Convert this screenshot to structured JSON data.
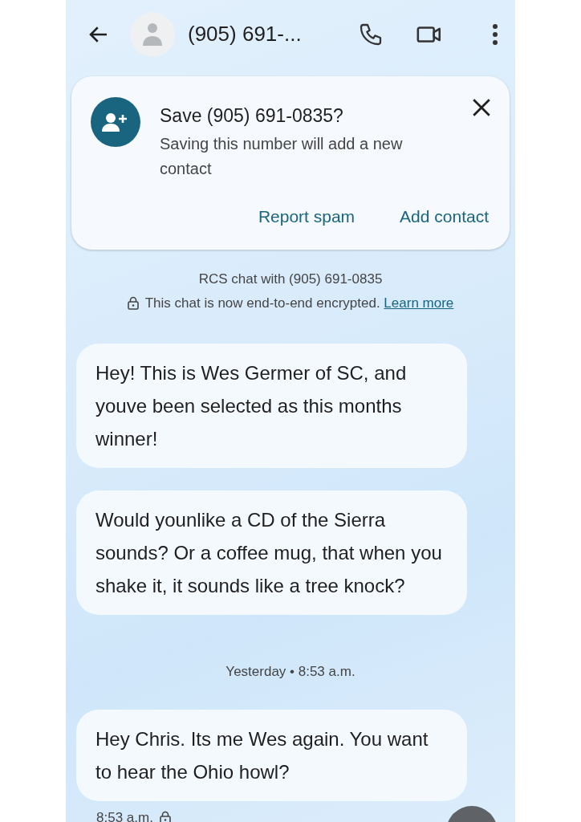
{
  "header": {
    "title": "(905) 691-..."
  },
  "save_banner": {
    "title": "Save (905) 691-0835?",
    "message": "Saving this number will add a new contact",
    "actions": [
      "Report spam",
      "Add contact"
    ]
  },
  "chat_info": {
    "line": "RCS chat with (905) 691-0835",
    "encryption_text": "This chat is now end-to-end encrypted.",
    "link": "Learn more"
  },
  "messages": [
    {
      "kind": "bubble",
      "text": "Hey! This is Wes Germer of SC, and youve been selected as this months winner!"
    },
    {
      "kind": "bubble",
      "text": "Would younlike a CD of the Sierra sounds? Or a coffee mug, that when you shake it, it sounds like a tree knock?"
    },
    {
      "kind": "divider",
      "text": "Yesterday • 8:53 a.m."
    },
    {
      "kind": "bubble",
      "text": "Hey Chris. Its me Wes again. You want to hear the Ohio howl?"
    }
  ],
  "footer": {
    "time": "8:53 a.m."
  }
}
